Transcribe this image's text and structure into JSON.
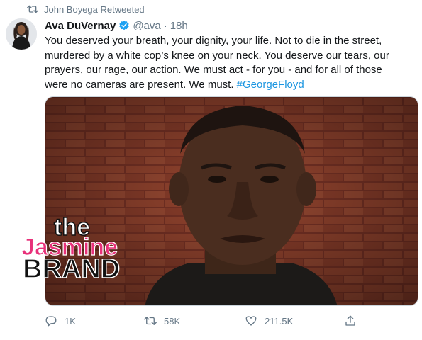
{
  "retweet_banner": {
    "icon": "retweet-icon",
    "text": "John Boyega Retweeted"
  },
  "tweet": {
    "display_name": "Ava DuVernay",
    "verified_icon": "verified-badge-icon",
    "handle": "@ava",
    "separator": "·",
    "time": "18h",
    "text_line1": "You deserved your breath, your dignity, your life. Not to die in the street,",
    "text_line2": "murdered by a white cop’s knee on your neck. You deserve our tears, our",
    "text_line3": "prayers, our rage, our action. We must act - for you - and for all of those",
    "text_line4_prefix": "were no cameras are present. We must. ",
    "hashtag": "#GeorgeFloyd"
  },
  "watermark": {
    "line1": "the",
    "line2": "Jasmine",
    "line3": "BRAND"
  },
  "actions": {
    "reply": {
      "icon": "reply-icon",
      "count": "1K"
    },
    "retweet": {
      "icon": "retweet-icon",
      "count": "58K"
    },
    "like": {
      "icon": "heart-icon",
      "count": "211.5K"
    },
    "share": {
      "icon": "share-icon"
    }
  },
  "colors": {
    "accent": "#1b95e0",
    "muted": "#657786",
    "verified": "#1da1f2",
    "watermark_pink": "#e8317a"
  }
}
